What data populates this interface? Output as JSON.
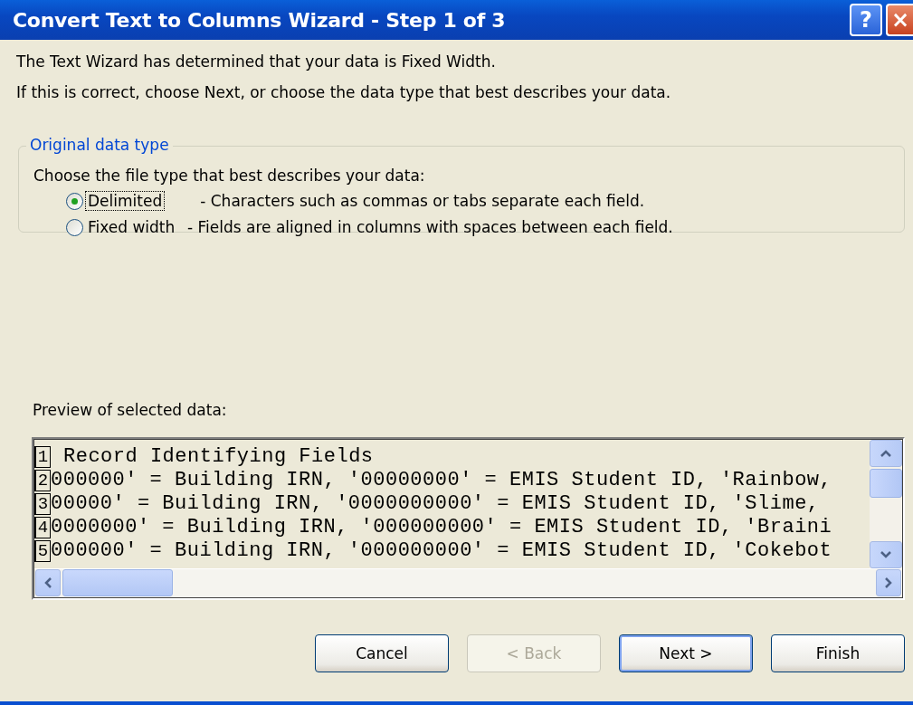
{
  "window": {
    "title": "Convert Text to Columns Wizard - Step 1 of 3",
    "title_buttons": [
      "?",
      "×"
    ]
  },
  "intro": [
    "The Text Wizard has determined that your data is Fixed Width.",
    "If this is correct, choose Next, or choose the data type that best describes your data."
  ],
  "group": {
    "title": "Original data type",
    "prompt": "Choose the file type that best describes your data:",
    "options": [
      {
        "label": "Delimited",
        "description": "- Characters such as commas or tabs separate each field.",
        "selected": true,
        "focused": true
      },
      {
        "label": "Fixed width",
        "description": "- Fields are aligned in columns with spaces between each field.",
        "selected": false,
        "focused": false
      }
    ]
  },
  "preview": {
    "label": "Preview of selected data:",
    "rows": [
      {
        "number": "1",
        "text": "Record Identifying Fields"
      },
      {
        "number": "2",
        "text": "000000' = Building IRN, '00000000' = EMIS Student ID, 'Rainbow,"
      },
      {
        "number": "3",
        "text": "00000' = Building IRN, '0000000000' = EMIS Student ID, 'Slime,"
      },
      {
        "number": "4",
        "text": "0000000' = Building IRN, '000000000' = EMIS Student ID, 'Braini"
      },
      {
        "number": "5",
        "text": "000000' = Building IRN, '000000000' = EMIS Student ID, 'Cokebot"
      }
    ]
  },
  "buttons": [
    {
      "label": "Cancel",
      "disabled": false,
      "default": false
    },
    {
      "label": "< Back",
      "disabled": true,
      "default": false
    },
    {
      "label": "Next >",
      "disabled": false,
      "default": true
    },
    {
      "label": "Finish",
      "disabled": false,
      "default": false
    }
  ]
}
